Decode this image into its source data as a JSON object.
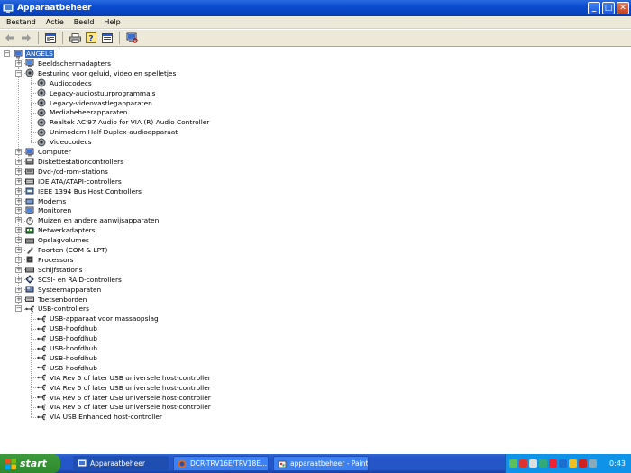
{
  "window": {
    "title": "Apparaatbeheer"
  },
  "menu": [
    "Bestand",
    "Actie",
    "Beeld",
    "Help"
  ],
  "tree": {
    "root": "ANGELS",
    "nodes": [
      {
        "label": "Beeldschermadapters",
        "level": 1,
        "expander": "+",
        "icon": "monitor-icon"
      },
      {
        "label": "Besturing voor geluid, video en spelletjes",
        "level": 1,
        "expander": "-",
        "icon": "speaker-icon"
      },
      {
        "label": "Audiocodecs",
        "level": 2,
        "icon": "speaker-icon"
      },
      {
        "label": "Legacy-audiostuurprogramma's",
        "level": 2,
        "icon": "speaker-icon"
      },
      {
        "label": "Legacy-videovastlegapparaten",
        "level": 2,
        "icon": "speaker-icon"
      },
      {
        "label": "Mediabeheerapparaten",
        "level": 2,
        "icon": "speaker-icon"
      },
      {
        "label": "Realtek AC'97 Audio for VIA (R) Audio Controller",
        "level": 2,
        "icon": "speaker-icon"
      },
      {
        "label": "Unimodem Half-Duplex-audioapparaat",
        "level": 2,
        "icon": "speaker-icon"
      },
      {
        "label": "Videocodecs",
        "level": 2,
        "icon": "speaker-icon"
      },
      {
        "label": "Computer",
        "level": 1,
        "expander": "+",
        "icon": "computer-icon"
      },
      {
        "label": "Diskettestationcontrollers",
        "level": 1,
        "expander": "+",
        "icon": "floppy-controller-icon"
      },
      {
        "label": "Dvd-/cd-rom-stations",
        "level": 1,
        "expander": "+",
        "icon": "cdrom-icon"
      },
      {
        "label": "IDE ATA/ATAPI-controllers",
        "level": 1,
        "expander": "+",
        "icon": "ide-icon"
      },
      {
        "label": "IEEE 1394 Bus Host Controllers",
        "level": 1,
        "expander": "+",
        "icon": "firewire-icon"
      },
      {
        "label": "Modems",
        "level": 1,
        "expander": "+",
        "icon": "modem-icon"
      },
      {
        "label": "Monitoren",
        "level": 1,
        "expander": "+",
        "icon": "monitor-icon"
      },
      {
        "label": "Muizen en andere aanwijsapparaten",
        "level": 1,
        "expander": "+",
        "icon": "mouse-icon"
      },
      {
        "label": "Netwerkadapters",
        "level": 1,
        "expander": "+",
        "icon": "network-icon"
      },
      {
        "label": "Opslagvolumes",
        "level": 1,
        "expander": "+",
        "icon": "drive-icon"
      },
      {
        "label": "Poorten (COM & LPT)",
        "level": 1,
        "expander": "+",
        "icon": "port-icon"
      },
      {
        "label": "Processors",
        "level": 1,
        "expander": "+",
        "icon": "processor-icon"
      },
      {
        "label": "Schijfstations",
        "level": 1,
        "expander": "+",
        "icon": "drive-icon"
      },
      {
        "label": "SCSI- en RAID-controllers",
        "level": 1,
        "expander": "+",
        "icon": "scsi-icon"
      },
      {
        "label": "Systeemapparaten",
        "level": 1,
        "expander": "+",
        "icon": "system-icon"
      },
      {
        "label": "Toetsenborden",
        "level": 1,
        "expander": "+",
        "icon": "keyboard-icon"
      },
      {
        "label": "USB-controllers",
        "level": 1,
        "expander": "-",
        "icon": "usb-icon"
      },
      {
        "label": "USB-apparaat voor massaopslag",
        "level": 2,
        "icon": "usb-icon"
      },
      {
        "label": "USB-hoofdhub",
        "level": 2,
        "icon": "usb-icon"
      },
      {
        "label": "USB-hoofdhub",
        "level": 2,
        "icon": "usb-icon"
      },
      {
        "label": "USB-hoofdhub",
        "level": 2,
        "icon": "usb-icon"
      },
      {
        "label": "USB-hoofdhub",
        "level": 2,
        "icon": "usb-icon"
      },
      {
        "label": "USB-hoofdhub",
        "level": 2,
        "icon": "usb-icon"
      },
      {
        "label": "VIA Rev 5 of later USB universele host-controller",
        "level": 2,
        "icon": "usb-icon"
      },
      {
        "label": "VIA Rev 5 of later USB universele host-controller",
        "level": 2,
        "icon": "usb-icon"
      },
      {
        "label": "VIA Rev 5 of later USB universele host-controller",
        "level": 2,
        "icon": "usb-icon"
      },
      {
        "label": "VIA Rev 5 of later USB universele host-controller",
        "level": 2,
        "icon": "usb-icon"
      },
      {
        "label": "VIA USB Enhanced host-controller",
        "level": 2,
        "icon": "usb-icon"
      }
    ]
  },
  "taskbar": {
    "start_label": "start",
    "tasks": [
      {
        "label": "Apparaatbeheer",
        "active": true,
        "icon": "device-manager-icon"
      },
      {
        "label": "DCR-TRV16E/TRV18E...",
        "active": false,
        "icon": "firefox-icon"
      },
      {
        "label": "apparaatbeheer - Paint",
        "active": false,
        "icon": "paint-icon"
      }
    ],
    "clock": "0:43"
  },
  "colors": {
    "title_bar": "#0a4bd0",
    "selection": "#316ac5",
    "taskbar": "#2456c8",
    "start": "#2d8a2d",
    "tray": "#0f93e8"
  }
}
